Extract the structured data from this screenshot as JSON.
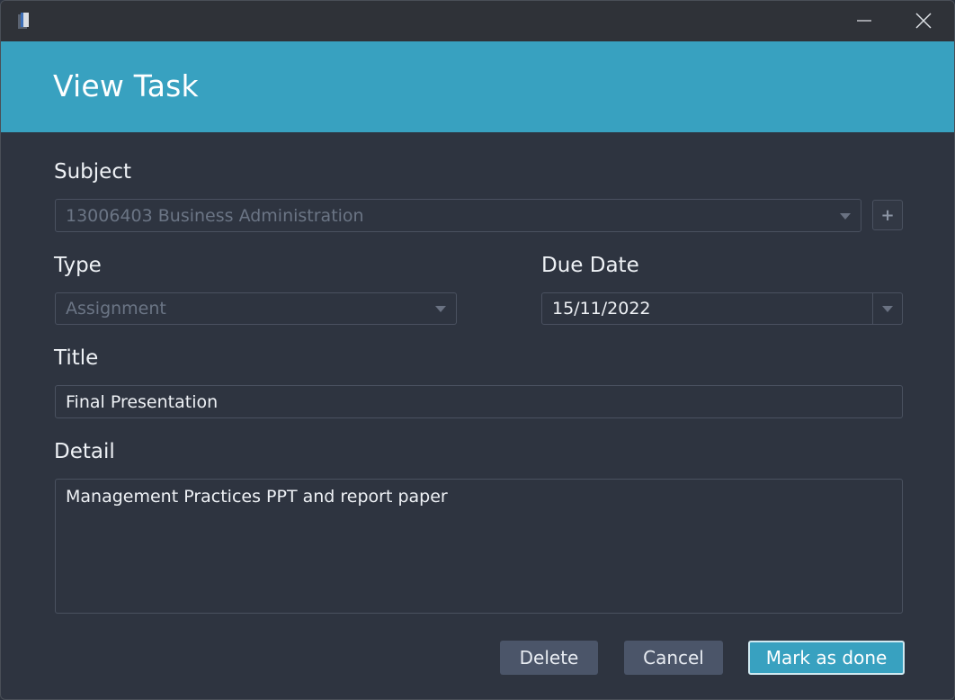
{
  "window": {
    "icon": "book-icon",
    "controls": {
      "minimize": "minimize-icon",
      "close": "close-icon"
    }
  },
  "header": {
    "title": "View Task",
    "color": "#38a1c0"
  },
  "form": {
    "subject": {
      "label": "Subject",
      "value": "13006403 Business Administration",
      "add_icon": "+"
    },
    "type": {
      "label": "Type",
      "value": "Assignment"
    },
    "due_date": {
      "label": "Due Date",
      "value": "15/11/2022"
    },
    "title": {
      "label": "Title",
      "value": "Final Presentation"
    },
    "detail": {
      "label": "Detail",
      "value": "Management Practices PPT and report paper"
    }
  },
  "actions": {
    "delete_label": "Delete",
    "cancel_label": "Cancel",
    "done_label": "Mark as done"
  }
}
